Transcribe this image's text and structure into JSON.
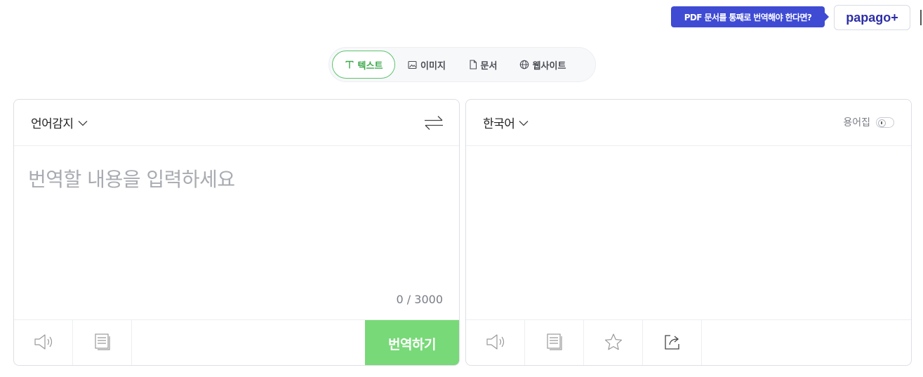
{
  "promo": {
    "text": "PDF 문서를 통째로 번역해야 한다면?"
  },
  "brand": {
    "name": "papago+"
  },
  "modes": [
    {
      "label": "텍스트",
      "icon": "text-icon",
      "active": true
    },
    {
      "label": "이미지",
      "icon": "image-icon",
      "active": false
    },
    {
      "label": "문서",
      "icon": "document-icon",
      "active": false
    },
    {
      "label": "웹사이트",
      "icon": "globe-icon",
      "active": false
    }
  ],
  "source": {
    "language": "언어감지",
    "placeholder": "번역할 내용을 입력하세요",
    "value": "",
    "counter": "0 / 3000",
    "translate_label": "번역하기"
  },
  "target": {
    "language": "한국어",
    "glossary_label": "용어집"
  },
  "colors": {
    "accent": "#5cc36c",
    "translate_button": "#77d977",
    "promo": "#3f4bd3",
    "brand": "#2d2fa5"
  }
}
